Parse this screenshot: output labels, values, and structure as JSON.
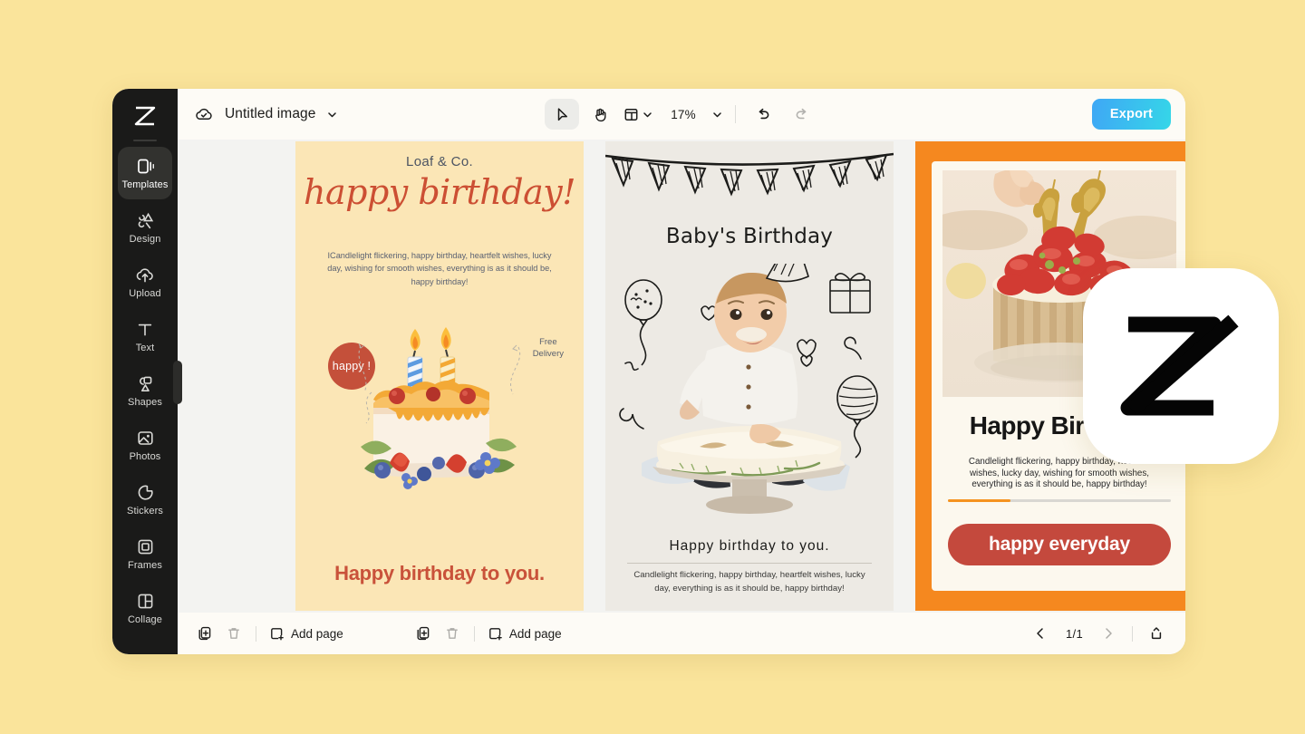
{
  "window": {
    "title": "Untitled image",
    "cloud_status_icon": "cloud-check-icon",
    "title_caret_icon": "chevron-down-icon"
  },
  "toolbar": {
    "select_tool_icon": "cursor-arrow-icon",
    "hand_tool_icon": "hand-icon",
    "layout_tool_icon": "layout-grid-icon",
    "layout_caret_icon": "chevron-down-icon",
    "zoom_value": "17%",
    "zoom_caret_icon": "chevron-down-icon",
    "undo_icon": "undo-icon",
    "redo_icon": "redo-icon",
    "export_label": "Export",
    "export_gradient_from": "#3FA7F5",
    "export_gradient_to": "#35D6E8"
  },
  "sidebar": {
    "logo_icon": "capcut-logo-icon",
    "items": [
      {
        "label": "Templates",
        "icon": "templates-icon",
        "active": true
      },
      {
        "label": "Design",
        "icon": "design-icon",
        "active": false
      },
      {
        "label": "Upload",
        "icon": "upload-cloud-icon",
        "active": false
      },
      {
        "label": "Text",
        "icon": "text-icon",
        "active": false
      },
      {
        "label": "Shapes",
        "icon": "shapes-icon",
        "active": false
      },
      {
        "label": "Photos",
        "icon": "photos-icon",
        "active": false
      },
      {
        "label": "Stickers",
        "icon": "stickers-icon",
        "active": false
      },
      {
        "label": "Frames",
        "icon": "frames-icon",
        "active": false
      },
      {
        "label": "Collage",
        "icon": "collage-icon",
        "active": false
      }
    ]
  },
  "canvas": {
    "cards": [
      {
        "id": "card-birthday-cream",
        "background": "#FBE6B6",
        "brand": "Loaf & Co.",
        "script_title": "happy birthday!",
        "body": "ICandlelight flickering,  happy birthday, heartfelt wishes, lucky day, wishing for smooth wishes, everything is as it should be,  happy birthday!",
        "badge": "happy !",
        "badge_color": "#C4503A",
        "side_note": "Free\nDelivery",
        "side_note_line1": "Free",
        "side_note_line2": "Delivery",
        "footer": "Happy birthday to you.",
        "footer_color": "#C9523A",
        "art": "watercolor-birthday-cake-with-two-candles-berries"
      },
      {
        "id": "card-babys-birthday",
        "background": "#EDEAE4",
        "title": "Baby's Birthday",
        "subtitle": "Happy birthday  to you.",
        "body": "Candlelight flickering,  happy birthday, heartfelt wishes, lucky day,  everything is as it should be,  happy birthday!",
        "art": "baby-with-party-hat-and-smash-cake-doodles"
      },
      {
        "id": "card-happy-everyday",
        "frame_color": "#F5881F",
        "background": "#FCF8EE",
        "title": "Happy Birthday",
        "body": "Candlelight flickering,  happy birthday, heartfelt wishes, lucky day, wishing for smooth wishes, everything is as it should be,  happy birthday!",
        "progress_percent": 28,
        "progress_color": "#F5931F",
        "button_label": "happy everyday",
        "button_color": "#C4493D",
        "art": "strawberry-cake-with-gold-17-candles"
      }
    ]
  },
  "bottombar": {
    "duplicate_icon": "duplicate-page-icon",
    "delete_icon": "trash-icon",
    "add_page_icon": "add-page-icon",
    "add_page_label_1": "Add page",
    "add_page_label_2": "Add page",
    "prev_icon": "chevron-left-icon",
    "page_indicator": "1/1",
    "next_icon": "chevron-right-icon",
    "export_page_icon": "export-page-icon"
  },
  "overlay": {
    "logo_icon": "capcut-logo-icon",
    "logo_background": "#FFFFFF"
  },
  "theme": {
    "page_background": "#FAE49B",
    "window_background": "#FDFBF6",
    "canvas_background": "#F3F3F1",
    "rail_background": "#1A1A19"
  }
}
